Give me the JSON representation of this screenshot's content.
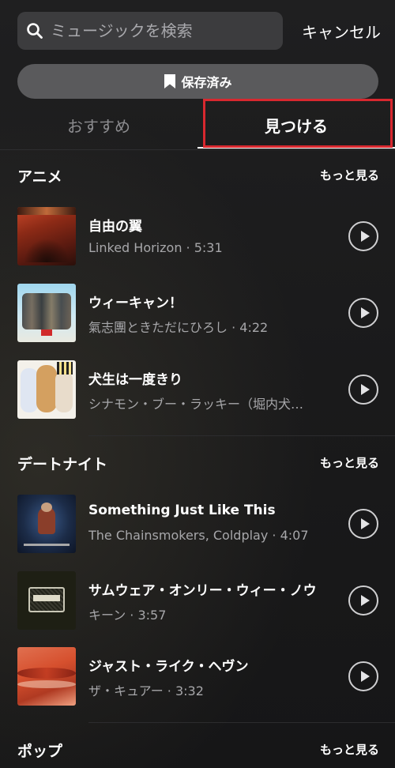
{
  "search": {
    "placeholder": "ミュージックを検索",
    "cancel_label": "キャンセル"
  },
  "saved_button": {
    "label": "保存済み"
  },
  "tabs": [
    {
      "label": "おすすめ",
      "selected": false
    },
    {
      "label": "見つける",
      "selected": true
    }
  ],
  "sections": [
    {
      "title": "アニメ",
      "more_label": "もっと見る",
      "tracks": [
        {
          "title": "自由の翼",
          "subtitle": "Linked Horizon · 5:31"
        },
        {
          "title": "ウィーキャン！",
          "subtitle": "氣志團ときただにひろし · 4:22"
        },
        {
          "title": "犬生は一度きり",
          "subtitle": "シナモン・ブー・ラッキー（堀内犬…"
        }
      ]
    },
    {
      "title": "デートナイト",
      "more_label": "もっと見る",
      "tracks": [
        {
          "title": "Something Just Like This",
          "subtitle": "The Chainsmokers, Coldplay · 4:07"
        },
        {
          "title": "サムウェア・オンリー・ウィー・ノウ",
          "subtitle": "キーン · 3:57"
        },
        {
          "title": "ジャスト・ライク・ヘヴン",
          "subtitle": "ザ・キュアー · 3:32"
        }
      ]
    },
    {
      "title": "ポップ",
      "more_label": "もっと見る",
      "tracks": []
    }
  ],
  "colors": {
    "background": "#1b1b1c",
    "search_field": "#3c3c3e",
    "saved_button": "#5a5a5c",
    "inactive_tab": "#8c8c8f",
    "secondary_text": "#a7a7aa",
    "highlight_box": "#d8282f"
  },
  "icons": {
    "search": "search-icon",
    "saved": "bookmark-icon",
    "play": "play-icon"
  }
}
